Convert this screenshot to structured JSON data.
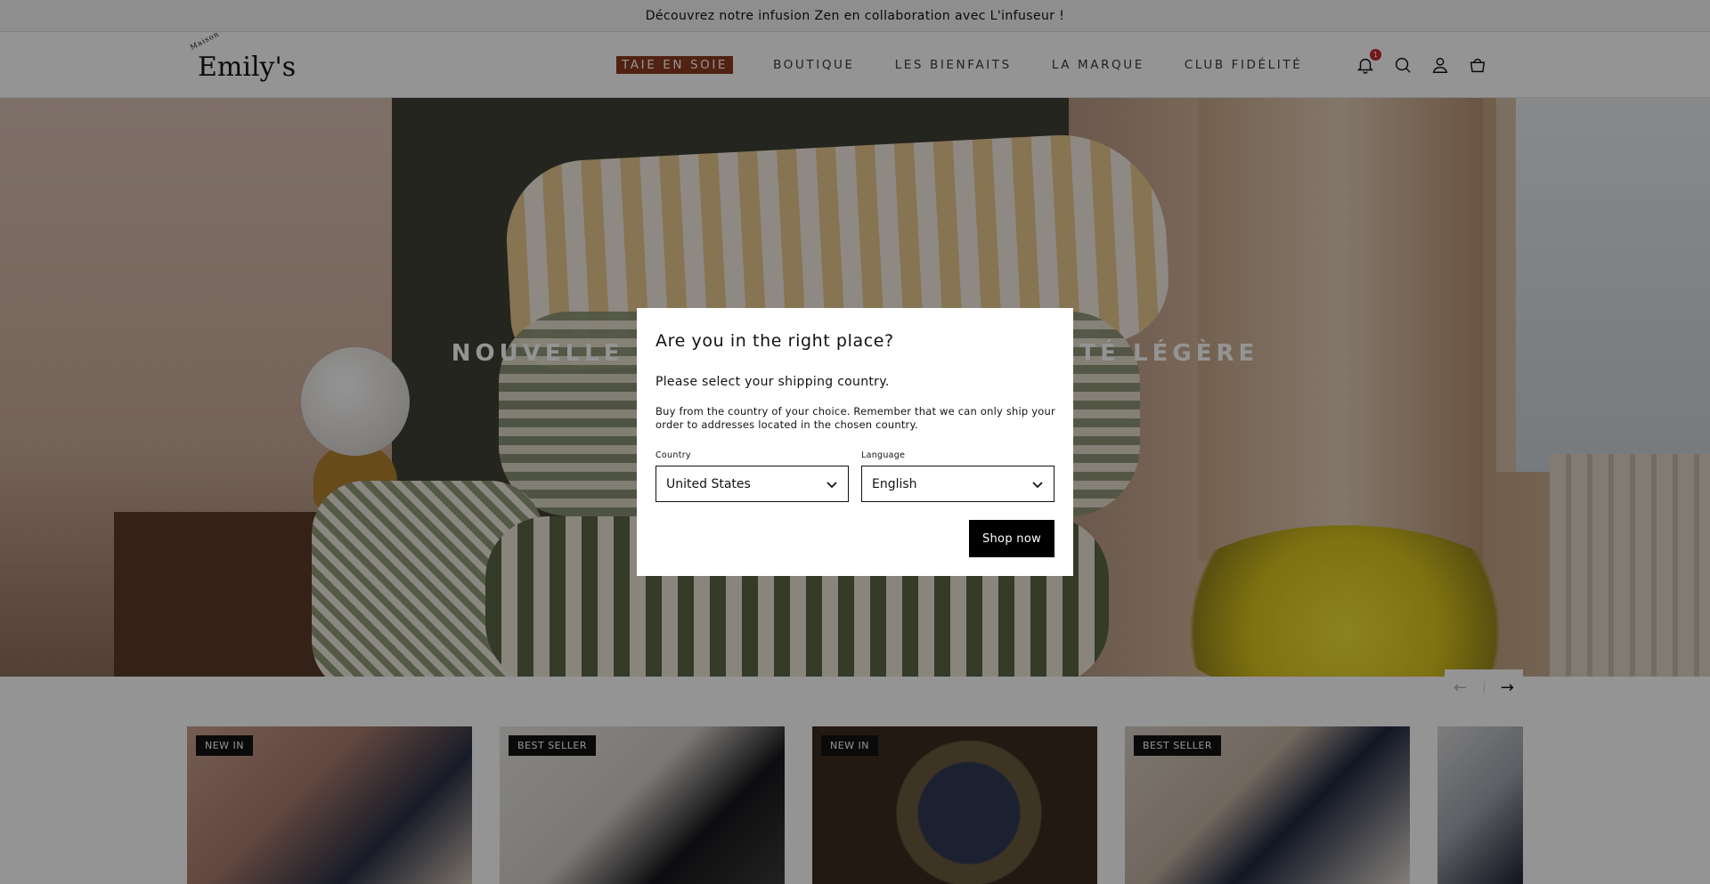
{
  "announcement": {
    "text": "Découvrez notre infusion Zen en collaboration avec L'infuseur !"
  },
  "header": {
    "logo_sub": "Maison",
    "logo_name": "Emily's",
    "nav": [
      {
        "label": "TAIE EN SOIE"
      },
      {
        "label": "BOUTIQUE"
      },
      {
        "label": "LES BIENFAITS"
      },
      {
        "label": "LA MARQUE"
      },
      {
        "label": "CLUB FIDÉLITÉ"
      }
    ],
    "notification_count": "1",
    "icons": [
      "bell-icon",
      "search-icon",
      "account-icon",
      "cart-icon"
    ]
  },
  "hero": {
    "title": "NOUVELLE COLLECTION PRINTEMPS ÉTÉ LÉGÈRE"
  },
  "carousel": {
    "prev_icon": "arrow-left-icon",
    "next_icon": "arrow-right-icon"
  },
  "products": [
    {
      "badge": "NEW IN"
    },
    {
      "badge": "BEST SELLER"
    },
    {
      "badge": "NEW IN"
    },
    {
      "badge": "BEST SELLER"
    },
    {
      "badge": ""
    }
  ],
  "modal": {
    "title": "Are you in the right place?",
    "lead": "Please select your shipping country.",
    "description": "Buy from the country of your choice. Remember that we can only ship your order to addresses located in the chosen country.",
    "country_label": "Country",
    "country_value": "United States",
    "language_label": "Language",
    "language_value": "English",
    "button_label": "Shop now"
  },
  "colors": {
    "accent_nav_highlight": "#8c3b1e",
    "badge_bg": "#121212",
    "button_bg": "#000000",
    "notification_badge": "#c62828"
  }
}
